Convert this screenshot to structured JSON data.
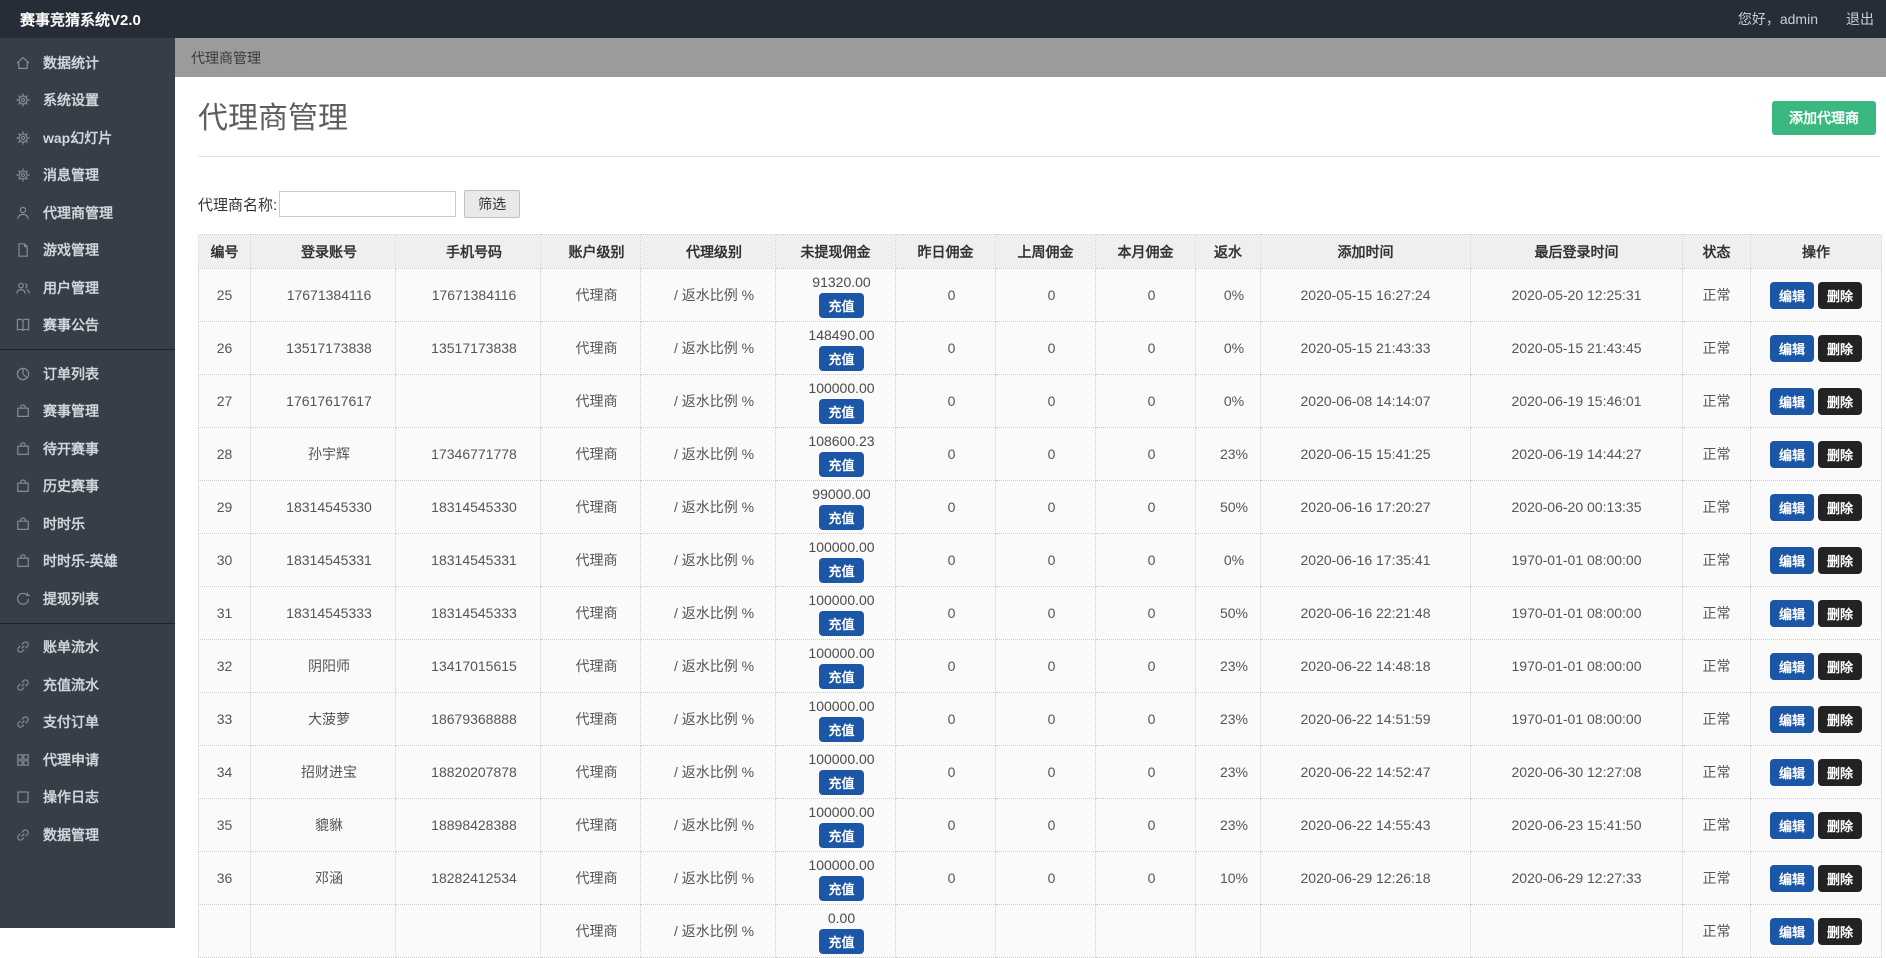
{
  "topbar": {
    "brand": "赛事竞猜系统V2.0",
    "greeting": "您好，admin",
    "logout": "退出"
  },
  "breadcrumb": "代理商管理",
  "sidebar": {
    "groups": [
      [
        {
          "key": "stats",
          "icon": "home",
          "label": "数据统计"
        },
        {
          "key": "system-settings",
          "icon": "gear",
          "label": "系统设置"
        },
        {
          "key": "wap-slides",
          "icon": "gear",
          "label": "wap幻灯片"
        },
        {
          "key": "message-mgmt",
          "icon": "gear",
          "label": "消息管理"
        },
        {
          "key": "agent-mgmt",
          "icon": "user",
          "label": "代理商管理"
        },
        {
          "key": "game-mgmt",
          "icon": "file",
          "label": "游戏管理"
        },
        {
          "key": "user-mgmt",
          "icon": "users",
          "label": "用户管理"
        },
        {
          "key": "match-announcement",
          "icon": "book",
          "label": "赛事公告"
        }
      ],
      [
        {
          "key": "order-list",
          "icon": "pie",
          "label": "订单列表"
        },
        {
          "key": "match-mgmt",
          "icon": "bag",
          "label": "赛事管理"
        },
        {
          "key": "pending-matches",
          "icon": "bag",
          "label": "待开赛事"
        },
        {
          "key": "history-matches",
          "icon": "bag",
          "label": "历史赛事"
        },
        {
          "key": "shishile",
          "icon": "bag",
          "label": "时时乐"
        },
        {
          "key": "shishile-hero",
          "icon": "bag",
          "label": "时时乐-英雄"
        },
        {
          "key": "withdraw-list",
          "icon": "refresh",
          "label": "提现列表"
        }
      ],
      [
        {
          "key": "bill-flow",
          "icon": "link",
          "label": "账单流水"
        },
        {
          "key": "recharge-flow",
          "icon": "link",
          "label": "充值流水"
        },
        {
          "key": "payment-orders",
          "icon": "link",
          "label": "支付订单"
        },
        {
          "key": "agent-apply",
          "icon": "grid",
          "label": "代理申请"
        },
        {
          "key": "operation-log",
          "icon": "square",
          "label": "操作日志"
        },
        {
          "key": "data-mgmt",
          "icon": "link",
          "label": "数据管理"
        }
      ]
    ]
  },
  "page": {
    "title": "代理商管理",
    "add_button": "添加代理商",
    "filter_label": "代理商名称:",
    "filter_input_value": "",
    "filter_button": "筛选",
    "recharge_label": "充值",
    "edit_label": "编辑",
    "delete_label": "删除"
  },
  "table": {
    "headers": [
      "编号",
      "登录账号",
      "手机号码",
      "账户级别",
      "代理级别",
      "未提现佣金",
      "昨日佣金",
      "上周佣金",
      "本月佣金",
      "返水",
      "添加时间",
      "最后登录时间",
      "状态",
      "操作"
    ],
    "rows": [
      {
        "id": "25",
        "account": "17671384116",
        "phone": "17671384116",
        "account_level": "代理商",
        "agent_level": "/ 返水比例 %",
        "commission": "91320.00",
        "yesterday": "0",
        "last_week": "0",
        "this_month": "0",
        "rebate": "0%",
        "added_time": "2020-05-15 16:27:24",
        "last_login": "2020-05-20 12:25:31",
        "status": "正常"
      },
      {
        "id": "26",
        "account": "13517173838",
        "phone": "13517173838",
        "account_level": "代理商",
        "agent_level": "/ 返水比例 %",
        "commission": "148490.00",
        "yesterday": "0",
        "last_week": "0",
        "this_month": "0",
        "rebate": "0%",
        "added_time": "2020-05-15 21:43:33",
        "last_login": "2020-05-15 21:43:45",
        "status": "正常"
      },
      {
        "id": "27",
        "account": "17617617617",
        "phone": "",
        "account_level": "代理商",
        "agent_level": "/ 返水比例 %",
        "commission": "100000.00",
        "yesterday": "0",
        "last_week": "0",
        "this_month": "0",
        "rebate": "0%",
        "added_time": "2020-06-08 14:14:07",
        "last_login": "2020-06-19 15:46:01",
        "status": "正常"
      },
      {
        "id": "28",
        "account": "孙宇辉",
        "phone": "17346771778",
        "account_level": "代理商",
        "agent_level": "/ 返水比例 %",
        "commission": "108600.23",
        "yesterday": "0",
        "last_week": "0",
        "this_month": "0",
        "rebate": "23%",
        "added_time": "2020-06-15 15:41:25",
        "last_login": "2020-06-19 14:44:27",
        "status": "正常"
      },
      {
        "id": "29",
        "account": "18314545330",
        "phone": "18314545330",
        "account_level": "代理商",
        "agent_level": "/ 返水比例 %",
        "commission": "99000.00",
        "yesterday": "0",
        "last_week": "0",
        "this_month": "0",
        "rebate": "50%",
        "added_time": "2020-06-16 17:20:27",
        "last_login": "2020-06-20 00:13:35",
        "status": "正常"
      },
      {
        "id": "30",
        "account": "18314545331",
        "phone": "18314545331",
        "account_level": "代理商",
        "agent_level": "/ 返水比例 %",
        "commission": "100000.00",
        "yesterday": "0",
        "last_week": "0",
        "this_month": "0",
        "rebate": "0%",
        "added_time": "2020-06-16 17:35:41",
        "last_login": "1970-01-01 08:00:00",
        "status": "正常"
      },
      {
        "id": "31",
        "account": "18314545333",
        "phone": "18314545333",
        "account_level": "代理商",
        "agent_level": "/ 返水比例 %",
        "commission": "100000.00",
        "yesterday": "0",
        "last_week": "0",
        "this_month": "0",
        "rebate": "50%",
        "added_time": "2020-06-16 22:21:48",
        "last_login": "1970-01-01 08:00:00",
        "status": "正常"
      },
      {
        "id": "32",
        "account": "阴阳师",
        "phone": "13417015615",
        "account_level": "代理商",
        "agent_level": "/ 返水比例 %",
        "commission": "100000.00",
        "yesterday": "0",
        "last_week": "0",
        "this_month": "0",
        "rebate": "23%",
        "added_time": "2020-06-22 14:48:18",
        "last_login": "1970-01-01 08:00:00",
        "status": "正常"
      },
      {
        "id": "33",
        "account": "大菠萝",
        "phone": "18679368888",
        "account_level": "代理商",
        "agent_level": "/ 返水比例 %",
        "commission": "100000.00",
        "yesterday": "0",
        "last_week": "0",
        "this_month": "0",
        "rebate": "23%",
        "added_time": "2020-06-22 14:51:59",
        "last_login": "1970-01-01 08:00:00",
        "status": "正常"
      },
      {
        "id": "34",
        "account": "招财进宝",
        "phone": "18820207878",
        "account_level": "代理商",
        "agent_level": "/ 返水比例 %",
        "commission": "100000.00",
        "yesterday": "0",
        "last_week": "0",
        "this_month": "0",
        "rebate": "23%",
        "added_time": "2020-06-22 14:52:47",
        "last_login": "2020-06-30 12:27:08",
        "status": "正常"
      },
      {
        "id": "35",
        "account": "貔貅",
        "phone": "18898428388",
        "account_level": "代理商",
        "agent_level": "/ 返水比例 %",
        "commission": "100000.00",
        "yesterday": "0",
        "last_week": "0",
        "this_month": "0",
        "rebate": "23%",
        "added_time": "2020-06-22 14:55:43",
        "last_login": "2020-06-23 15:41:50",
        "status": "正常"
      },
      {
        "id": "36",
        "account": "邓涵",
        "phone": "18282412534",
        "account_level": "代理商",
        "agent_level": "/ 返水比例 %",
        "commission": "100000.00",
        "yesterday": "0",
        "last_week": "0",
        "this_month": "0",
        "rebate": "10%",
        "added_time": "2020-06-29 12:26:18",
        "last_login": "2020-06-29 12:27:33",
        "status": "正常"
      },
      {
        "id": "",
        "account": "",
        "phone": "",
        "account_level": "代理商",
        "agent_level": "/ 返水比例 %",
        "commission": "0.00",
        "yesterday": "",
        "last_week": "",
        "this_month": "",
        "rebate": "",
        "added_time": "",
        "last_login": "",
        "status": "正常"
      }
    ]
  },
  "colors": {
    "topbar_bg": "#262d36",
    "sidebar_bg": "#373e48",
    "breadcrumb_bg": "#9b9b9b",
    "accent_green": "#3bb87f",
    "accent_blue": "#1c56a7",
    "delete_black": "#232323",
    "header_bg": "#efefef",
    "row_bg": "#fafafa"
  }
}
